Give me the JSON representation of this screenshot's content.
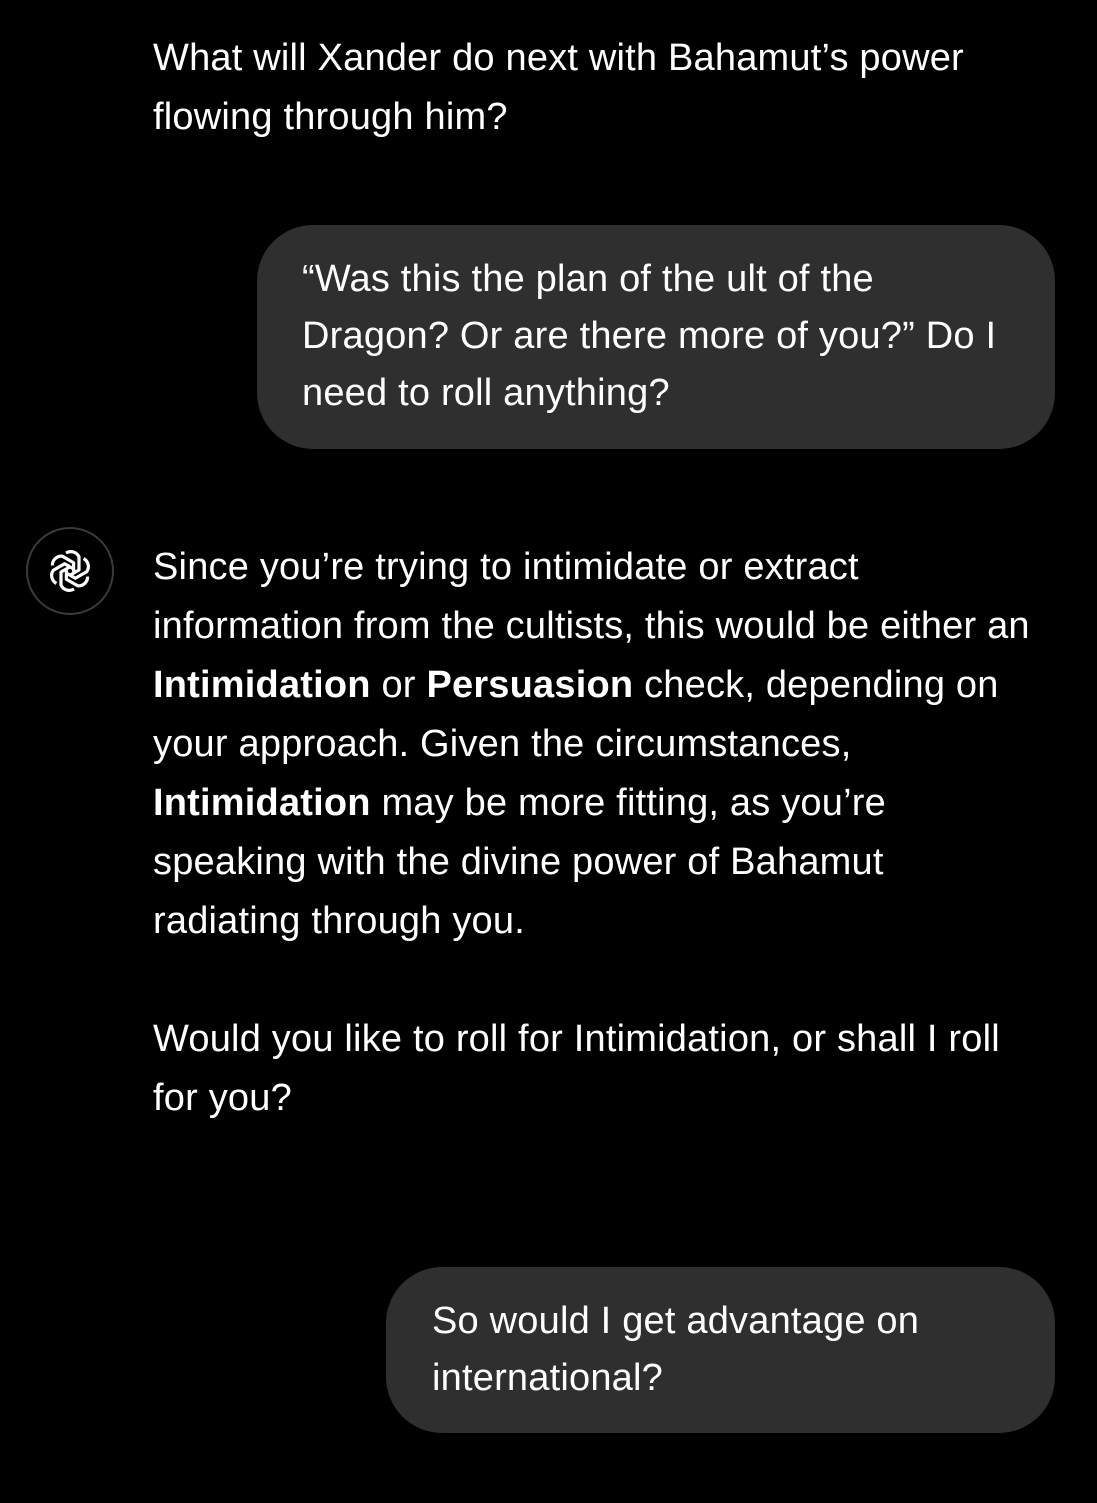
{
  "messages": {
    "assistant_prev": {
      "text": "What will Xander do next with Bahamut’s power flowing through him?"
    },
    "user_1": {
      "text": "“Was this the plan of the  ult of the Dragon? Or are there more of you?” Do I need to roll anything?"
    },
    "assistant_main": {
      "p1": {
        "t1": "Since you’re trying to intimidate or extract information from the cultists, this would be either an ",
        "b1": "Intimidation",
        "t2": " or ",
        "b2": "Persuasion",
        "t3": " check, depending on your approach. Given the circumstances, ",
        "b3": "Intimidation",
        "t4": " may be more fitting, as you’re speaking with the divine power of Bahamut radiating through you."
      },
      "p2": "Would you like to roll for Intimidation, or shall I roll for you?"
    },
    "user_2": {
      "text": "So would I get advantage on international?"
    }
  },
  "avatar": {
    "icon": "openai-logo-icon"
  },
  "colors": {
    "background": "#000000",
    "bubble": "#2f2f2f",
    "text": "#ffffff"
  }
}
